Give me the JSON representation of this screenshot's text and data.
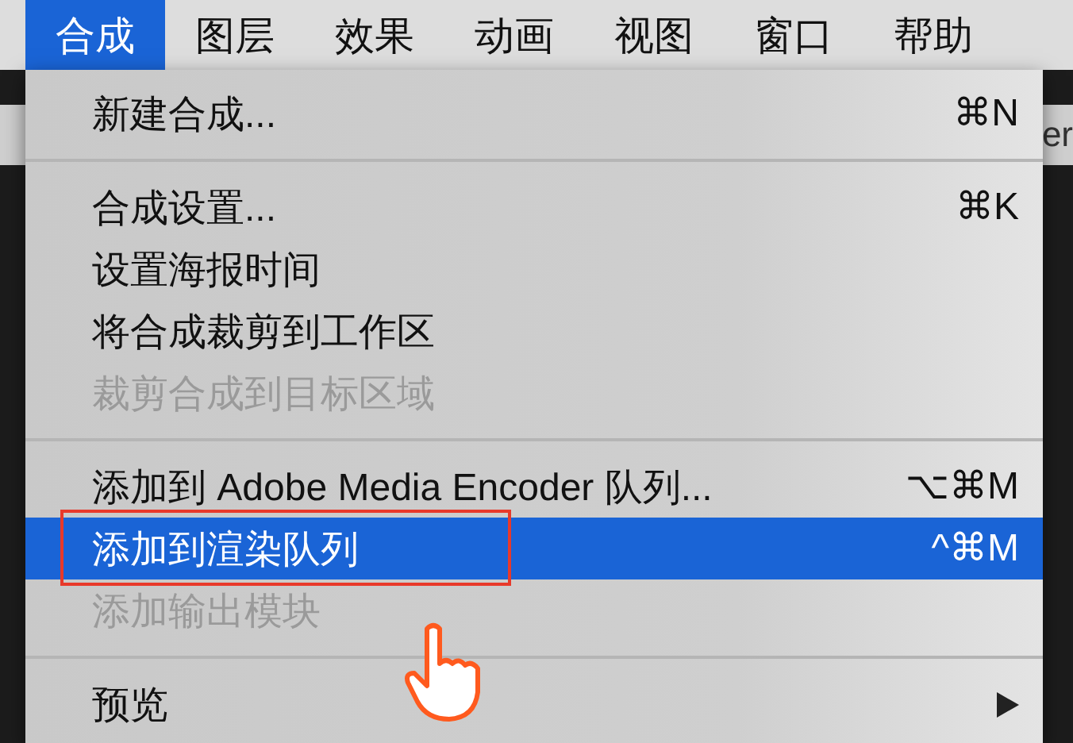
{
  "menu_bar": [
    {
      "label": "合成",
      "selected": true
    },
    {
      "label": "图层",
      "selected": false
    },
    {
      "label": "效果",
      "selected": false
    },
    {
      "label": "动画",
      "selected": false
    },
    {
      "label": "视图",
      "selected": false
    },
    {
      "label": "窗口",
      "selected": false
    },
    {
      "label": "帮助",
      "selected": false
    }
  ],
  "background_text": "er",
  "menu": [
    {
      "kind": "item",
      "label": "新建合成...",
      "shortcut": "⌘N",
      "disabled": false,
      "selected": false
    },
    {
      "kind": "separator"
    },
    {
      "kind": "item",
      "label": "合成设置...",
      "shortcut": "⌘K",
      "disabled": false,
      "selected": false
    },
    {
      "kind": "item",
      "label": "设置海报时间",
      "disabled": false,
      "selected": false
    },
    {
      "kind": "item",
      "label": "将合成裁剪到工作区",
      "disabled": false,
      "selected": false
    },
    {
      "kind": "item",
      "label": "裁剪合成到目标区域",
      "disabled": true,
      "selected": false
    },
    {
      "kind": "separator"
    },
    {
      "kind": "item",
      "label": "添加到 Adobe Media Encoder 队列...",
      "shortcut": "⌥⌘M",
      "disabled": false,
      "selected": false
    },
    {
      "kind": "item",
      "label": "添加到渲染队列",
      "shortcut": "^⌘M",
      "disabled": false,
      "selected": true,
      "annotated": true
    },
    {
      "kind": "item",
      "label": "添加输出模块",
      "disabled": true,
      "selected": false
    },
    {
      "kind": "separator"
    },
    {
      "kind": "item",
      "label": "预览",
      "disabled": false,
      "selected": false,
      "submenu": true
    }
  ]
}
